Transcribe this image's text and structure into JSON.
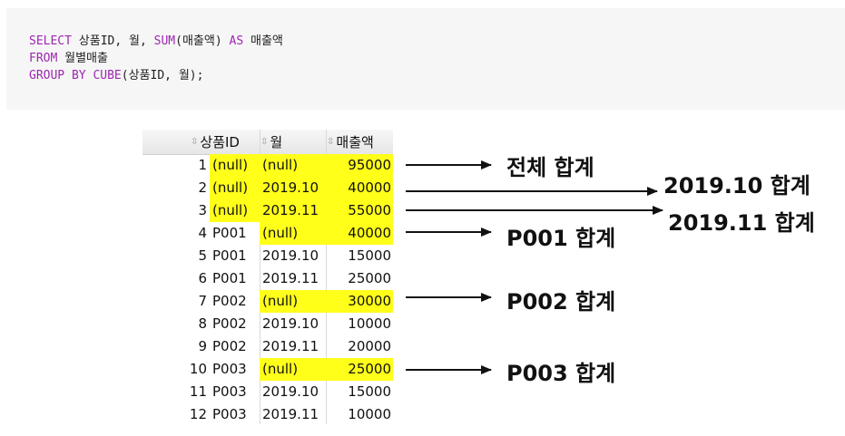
{
  "code": {
    "line1": [
      {
        "t": "SELECT",
        "kw": true
      },
      {
        "t": " 상품ID, 월, ",
        "kw": false
      },
      {
        "t": "SUM",
        "kw": true
      },
      {
        "t": "(매출액) ",
        "kw": false
      },
      {
        "t": "AS",
        "kw": true
      },
      {
        "t": " 매출액",
        "kw": false
      }
    ],
    "line2": [
      {
        "t": "FROM",
        "kw": true
      },
      {
        "t": " 월별매출",
        "kw": false
      }
    ],
    "line3": [
      {
        "t": "GROUP BY",
        "kw": true
      },
      {
        "t": " ",
        "kw": false
      },
      {
        "t": "CUBE",
        "kw": true
      },
      {
        "t": "(상품ID, 월);",
        "kw": false
      }
    ]
  },
  "grid": {
    "sort_glyph": "⇳",
    "headers": {
      "product": "상품ID",
      "month": "월",
      "sales": "매출액"
    },
    "rows": [
      {
        "n": "1",
        "product": "(null)",
        "month": "(null)",
        "sales": "95000",
        "hl": [
          true,
          true,
          true
        ]
      },
      {
        "n": "2",
        "product": "(null)",
        "month": "2019.10",
        "sales": "40000",
        "hl": [
          true,
          true,
          true
        ]
      },
      {
        "n": "3",
        "product": "(null)",
        "month": "2019.11",
        "sales": "55000",
        "hl": [
          true,
          true,
          true
        ]
      },
      {
        "n": "4",
        "product": "P001",
        "month": "(null)",
        "sales": "40000",
        "hl": [
          false,
          true,
          true
        ]
      },
      {
        "n": "5",
        "product": "P001",
        "month": "2019.10",
        "sales": "15000",
        "hl": [
          false,
          false,
          false
        ]
      },
      {
        "n": "6",
        "product": "P001",
        "month": "2019.11",
        "sales": "25000",
        "hl": [
          false,
          false,
          false
        ]
      },
      {
        "n": "7",
        "product": "P002",
        "month": "(null)",
        "sales": "30000",
        "hl": [
          false,
          true,
          true
        ]
      },
      {
        "n": "8",
        "product": "P002",
        "month": "2019.10",
        "sales": "10000",
        "hl": [
          false,
          false,
          false
        ]
      },
      {
        "n": "9",
        "product": "P002",
        "month": "2019.11",
        "sales": "20000",
        "hl": [
          false,
          false,
          false
        ]
      },
      {
        "n": "10",
        "product": "P003",
        "month": "(null)",
        "sales": "25000",
        "hl": [
          false,
          true,
          true
        ]
      },
      {
        "n": "11",
        "product": "P003",
        "month": "2019.10",
        "sales": "15000",
        "hl": [
          false,
          false,
          false
        ]
      },
      {
        "n": "12",
        "product": "P003",
        "month": "2019.11",
        "sales": "10000",
        "hl": [
          false,
          false,
          false
        ]
      }
    ]
  },
  "callouts": {
    "total": "전체 합계",
    "oct": "2019.10 합계",
    "nov": "2019.11 합계",
    "p001": "P001 합계",
    "p002": "P002 합계",
    "p003": "P003 합계"
  },
  "colors": {
    "highlight": "#ffff1a",
    "keyword": "#9c27b0"
  }
}
